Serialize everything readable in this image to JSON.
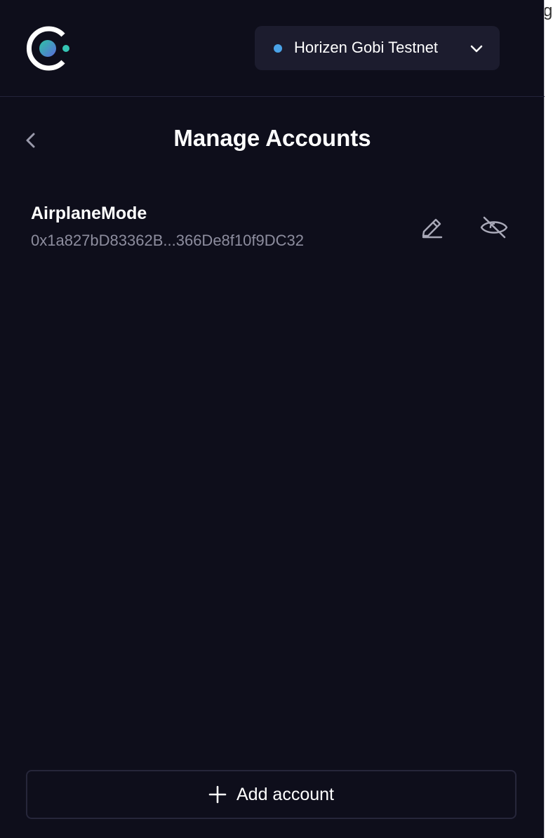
{
  "edge_text": "g",
  "header": {
    "logo_icon": "celo-logo-icon",
    "network": {
      "label": "Horizen Gobi Testnet",
      "status_color": "#4aa3e8",
      "icon": "chevron-down-icon"
    }
  },
  "page": {
    "title": "Manage Accounts",
    "back_icon": "chevron-left-icon"
  },
  "accounts": [
    {
      "name": "AirplaneMode",
      "address": "0x1a827bD83362B...366De8f10f9DC32",
      "edit_icon": "pencil-icon",
      "hide_icon": "eye-off-icon"
    }
  ],
  "footer": {
    "add_button_label": "Add account",
    "add_icon": "plus-icon"
  },
  "colors": {
    "background": "#0e0e1b",
    "surface": "#1c1c2e",
    "muted_text": "#8d8d9e",
    "text": "#ffffff"
  }
}
